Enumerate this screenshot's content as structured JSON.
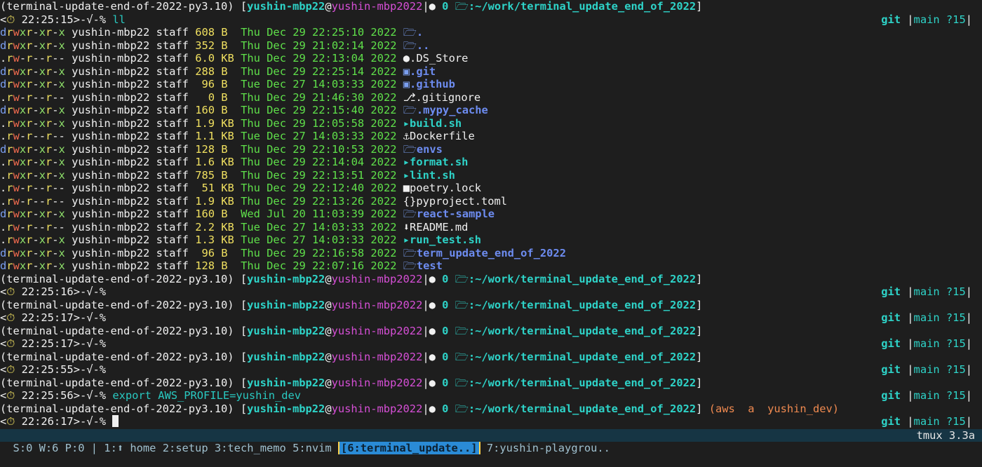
{
  "session": {
    "venv": "(terminal-update-end-of-2022-py3.10)",
    "user": "yushin-mbp22",
    "host": "yushin-mbp2022",
    "jobs": "0",
    "path": ":~/work/terminal_update_end_of_2022",
    "git_label": "git",
    "branch": "main",
    "untracked": "?15",
    "prompt_suffix": ">-√-%"
  },
  "prompts": [
    {
      "time": "22:25:15",
      "command": "ll",
      "aws": ""
    },
    {
      "time": "22:25:16",
      "command": "",
      "aws": ""
    },
    {
      "time": "22:25:17",
      "command": "",
      "aws": ""
    },
    {
      "time": "22:25:17",
      "command": "",
      "aws": ""
    },
    {
      "time": "22:25:55",
      "command": "",
      "aws": ""
    },
    {
      "time": "22:25:56",
      "command": "export AWS_PROFILE=yushin_dev",
      "aws": ""
    },
    {
      "time": "22:26:17",
      "command": "",
      "aws": "(aws  a  yushin_dev)"
    }
  ],
  "listing": [
    {
      "perm": "drwxr-xr-x",
      "owner": "yushin-mbp22",
      "group": "staff",
      "size": "608 B ",
      "date": "Thu Dec 29 22:25:10 2022",
      "icon": "folder-icon",
      "name": ".",
      "kind": "dir"
    },
    {
      "perm": "drwxr-xr-x",
      "owner": "yushin-mbp22",
      "group": "staff",
      "size": "352 B ",
      "date": "Thu Dec 29 21:02:14 2022",
      "icon": "folder-icon",
      "name": "..",
      "kind": "dir"
    },
    {
      "perm": ".rw-r--r--",
      "owner": "yushin-mbp22",
      "group": "staff",
      "size": "6.0 KB",
      "date": "Thu Dec 29 22:13:04 2022",
      "icon": "apple-icon",
      "name": ".DS_Store",
      "kind": "file"
    },
    {
      "perm": "drwxr-xr-x",
      "owner": "yushin-mbp22",
      "group": "staff",
      "size": "288 B ",
      "date": "Thu Dec 29 22:25:14 2022",
      "icon": "git-folder-icon",
      "name": ".git",
      "kind": "dir"
    },
    {
      "perm": "drwxr-xr-x",
      "owner": "yushin-mbp22",
      "group": "staff",
      "size": " 96 B ",
      "date": "Tue Dec 27 14:03:33 2022",
      "icon": "github-folder-icon",
      "name": ".github",
      "kind": "dir"
    },
    {
      "perm": ".rw-r--r--",
      "owner": "yushin-mbp22",
      "group": "staff",
      "size": "  0 B ",
      "date": "Thu Dec 29 21:46:30 2022",
      "icon": "git-icon",
      "name": ".gitignore",
      "kind": "file"
    },
    {
      "perm": "drwxr-xr-x",
      "owner": "yushin-mbp22",
      "group": "staff",
      "size": "160 B ",
      "date": "Thu Dec 29 22:15:40 2022",
      "icon": "folder-icon",
      "name": ".mypy_cache",
      "kind": "dir"
    },
    {
      "perm": ".rwxr-xr-x",
      "owner": "yushin-mbp22",
      "group": "staff",
      "size": "1.9 KB",
      "date": "Thu Dec 29 12:05:58 2022",
      "icon": "terminal-icon",
      "name": "build.sh",
      "kind": "exec"
    },
    {
      "perm": ".rw-r--r--",
      "owner": "yushin-mbp22",
      "group": "staff",
      "size": "1.1 KB",
      "date": "Tue Dec 27 14:03:33 2022",
      "icon": "docker-icon",
      "name": "Dockerfile",
      "kind": "file"
    },
    {
      "perm": "drwxr-xr-x",
      "owner": "yushin-mbp22",
      "group": "staff",
      "size": "128 B ",
      "date": "Thu Dec 29 22:10:53 2022",
      "icon": "folder-open-icon",
      "name": "envs",
      "kind": "dir"
    },
    {
      "perm": ".rwxr-xr-x",
      "owner": "yushin-mbp22",
      "group": "staff",
      "size": "1.6 KB",
      "date": "Thu Dec 29 22:14:04 2022",
      "icon": "terminal-icon",
      "name": "format.sh",
      "kind": "exec"
    },
    {
      "perm": ".rwxr-xr-x",
      "owner": "yushin-mbp22",
      "group": "staff",
      "size": "785 B ",
      "date": "Thu Dec 29 22:13:51 2022",
      "icon": "terminal-icon",
      "name": "lint.sh",
      "kind": "exec"
    },
    {
      "perm": ".rw-r--r--",
      "owner": "yushin-mbp22",
      "group": "staff",
      "size": " 51 KB",
      "date": "Thu Dec 29 22:12:40 2022",
      "icon": "lock-icon",
      "name": "poetry.lock",
      "kind": "file"
    },
    {
      "perm": ".rw-r--r--",
      "owner": "yushin-mbp22",
      "group": "staff",
      "size": "1.9 KB",
      "date": "Thu Dec 29 22:13:26 2022",
      "icon": "braces-icon",
      "name": "pyproject.toml",
      "kind": "file"
    },
    {
      "perm": "drwxr-xr-x",
      "owner": "yushin-mbp22",
      "group": "staff",
      "size": "160 B ",
      "date": "Wed Jul 20 11:03:39 2022",
      "icon": "folder-icon",
      "name": "react-sample",
      "kind": "dir"
    },
    {
      "perm": ".rw-r--r--",
      "owner": "yushin-mbp22",
      "group": "staff",
      "size": "2.2 KB",
      "date": "Tue Dec 27 14:03:33 2022",
      "icon": "download-icon",
      "name": "README.md",
      "kind": "file"
    },
    {
      "perm": ".rwxr-xr-x",
      "owner": "yushin-mbp22",
      "group": "staff",
      "size": "1.3 KB",
      "date": "Tue Dec 27 14:03:33 2022",
      "icon": "terminal-icon",
      "name": "run_test.sh",
      "kind": "exec"
    },
    {
      "perm": "drwxr-xr-x",
      "owner": "yushin-mbp22",
      "group": "staff",
      "size": " 96 B ",
      "date": "Thu Dec 29 22:16:58 2022",
      "icon": "folder-icon",
      "name": "term_update_end_of_2022",
      "kind": "dir"
    },
    {
      "perm": "drwxr-xr-x",
      "owner": "yushin-mbp22",
      "group": "staff",
      "size": "128 B ",
      "date": "Thu Dec 29 22:07:16 2022",
      "icon": "folder-icon",
      "name": "test",
      "kind": "dir"
    }
  ],
  "tmux": {
    "stats": "S:0 W:6 P:0",
    "windows": [
      {
        "label": "1:⬆ home",
        "active": false
      },
      {
        "label": "2:setup",
        "active": false
      },
      {
        "label": "3:tech_memo",
        "active": false
      },
      {
        "label": "5:nvim",
        "active": false
      },
      {
        "label": "[6:terminal_update..]",
        "active": true
      },
      {
        "label": "7:yushin-playgrou..",
        "active": false
      }
    ],
    "version": "tmux 3.3a"
  },
  "colors": {
    "background": "#1e1e1e",
    "status_bar": "#163544",
    "active_window": "#2a8bd6"
  }
}
